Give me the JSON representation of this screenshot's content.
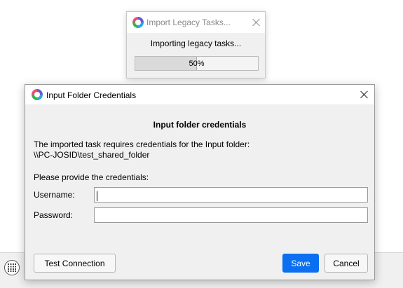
{
  "progress_dialog": {
    "title": "Import Legacy Tasks...",
    "message": "Importing legacy tasks...",
    "progress": 0.5,
    "progress_label": "50%"
  },
  "credentials_dialog": {
    "title": "Input Folder Credentials",
    "heading": "Input folder credentials",
    "description_line1": "The imported task requires credentials for the Input folder:",
    "description_line2": "\\\\PC-JOSID\\test_shared_folder",
    "prompt": "Please provide the credentials:",
    "username_label": "Username:",
    "username_value": "",
    "password_label": "Password:",
    "password_value": "",
    "test_connection_label": "Test Connection",
    "save_label": "Save",
    "cancel_label": "Cancel"
  },
  "colors": {
    "primary_button": "#0a6ff0",
    "dialog_background": "#f0f0f0"
  },
  "icons": {
    "app": "app-logo-icon",
    "bottom_bar": "grid-circle-icon"
  }
}
